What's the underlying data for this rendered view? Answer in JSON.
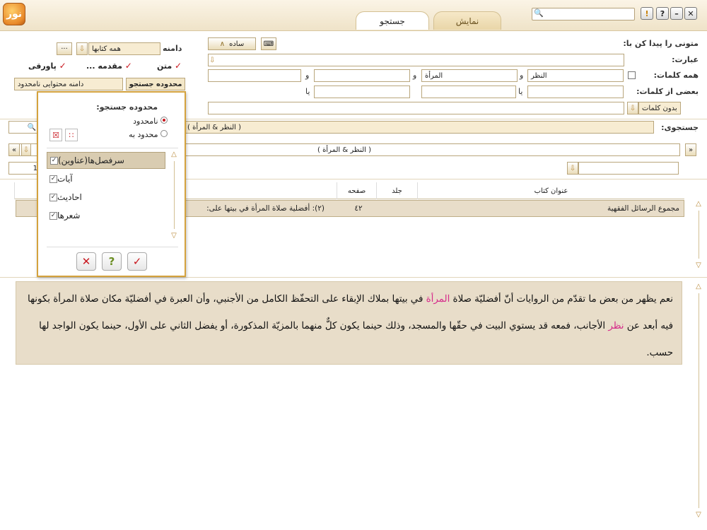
{
  "window": {
    "tabs": [
      {
        "label": "جستجو",
        "active": true
      },
      {
        "label": "نمایش",
        "active": false
      }
    ],
    "logo_text": "نور"
  },
  "search": {
    "find_texts_label": "متونی را پیدا کن با:",
    "phrase_label": "عبارت:",
    "all_words_label": "همه کلمات:",
    "some_words_label": "بعضی از کلمات:",
    "mode_label": "ساده",
    "and_sep": "و",
    "or_sep": "یا",
    "all_words": [
      "النظر",
      "المرأة",
      "",
      ""
    ],
    "some_words": [
      "",
      "",
      ""
    ],
    "without_words_label": "بدون کلمات",
    "domain_label": "دامنه",
    "domain_value": "همه کتابها",
    "checks": [
      {
        "label": "متن",
        "checked": true
      },
      {
        "label": "مقدمه ...",
        "checked": true
      },
      {
        "label": "پاورقی",
        "checked": true
      }
    ],
    "scope_button": "محدوده جستجو",
    "scope_value": "دامنه محتوایی نامحدود",
    "query_label": "جستجوی:",
    "query_value": "( النظر & المرأة )",
    "query_display": "( النظر & المرأة )",
    "page_value": "1"
  },
  "results": {
    "columns": [
      "عنوان کتاب",
      "جلد",
      "صفحه",
      "عنوان"
    ],
    "rows": [
      {
        "book": "مجموع الرسائل الفقهية",
        "volume": "",
        "page": "٤٢",
        "title": "(٢): أفضلية صلاة المرأة في بيتها على:"
      }
    ]
  },
  "reader": {
    "p1": "نعم يظهر من بعض ما تقدّم من الروايات أنّ أفضليّة صلاة ",
    "h1": "المرأة",
    "p2": " في بيتها بملاك الإبقاء على التحفّظ الكامل من الأجنبي، وأن العبرة في أفضليّة مكان صلاة المرأة بكونها فيه أبعد عن ",
    "h2": "نظر",
    "p3": " الأجانب، فمعه قد يستوي البيت في حقّها والمسجد، وذلك حينما يكون كلٌّ منهما بالمزيّة المذكورة، أو يفضل الثاني على الأول، حينما يكون الواجد لها حسب."
  },
  "scope_popup": {
    "title": "محدوده جستجو:",
    "options": [
      {
        "label": "نامحدود",
        "selected": true
      },
      {
        "label": "محدود به",
        "selected": false
      }
    ],
    "items": [
      {
        "label": "سرفصل‌ها(عناوین)",
        "checked": true,
        "selected": true
      },
      {
        "label": "آیات",
        "checked": true,
        "selected": false
      },
      {
        "label": "احادیث",
        "checked": true,
        "selected": false
      },
      {
        "label": "شعرها",
        "checked": true,
        "selected": false
      }
    ]
  },
  "colors": {
    "accent": "#d4a23d",
    "highlight": "#d62a8a",
    "row_bg": "#e8ddc9",
    "check_red": "#c8161d"
  }
}
